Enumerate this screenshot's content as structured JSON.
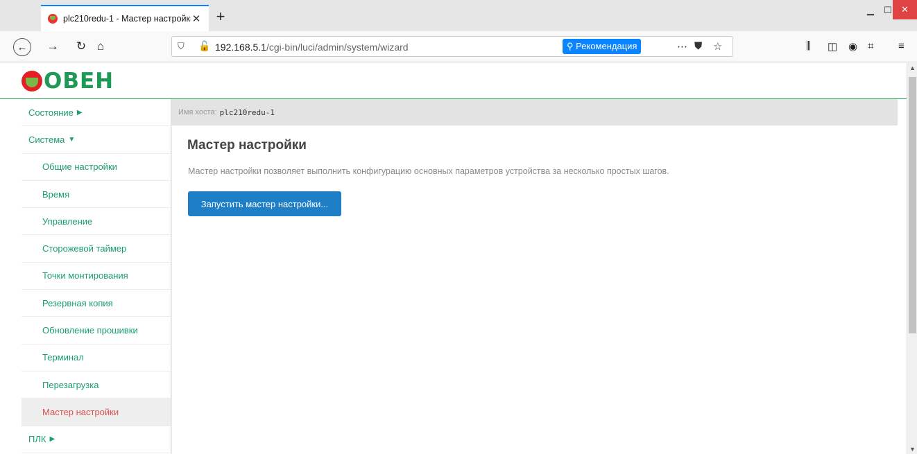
{
  "browser": {
    "tab_title": "plc210redu-1 - Мастер настройки",
    "new_tab": "+",
    "url_host": "192.168.5.1",
    "url_path": "/cgi-bin/luci/admin/system/wizard",
    "recommendation": "Рекомендация"
  },
  "logo_text": "ОВЕН",
  "host": {
    "label": "Имя хоста:",
    "value": "plc210redu-1"
  },
  "sidebar": {
    "items": [
      {
        "label": "Состояние",
        "type": "top",
        "caret": "▶"
      },
      {
        "label": "Система",
        "type": "top",
        "caret": "▼"
      },
      {
        "label": "Общие настройки",
        "type": "sub"
      },
      {
        "label": "Время",
        "type": "sub"
      },
      {
        "label": "Управление",
        "type": "sub"
      },
      {
        "label": "Сторожевой таймер",
        "type": "sub"
      },
      {
        "label": "Точки монтирования",
        "type": "sub"
      },
      {
        "label": "Резервная копия",
        "type": "sub"
      },
      {
        "label": "Обновление прошивки",
        "type": "sub"
      },
      {
        "label": "Терминал",
        "type": "sub"
      },
      {
        "label": "Перезагрузка",
        "type": "sub"
      },
      {
        "label": "Мастер настройки",
        "type": "sub",
        "active": true
      },
      {
        "label": "ПЛК",
        "type": "top",
        "caret": "▶"
      }
    ]
  },
  "main": {
    "title": "Мастер настройки",
    "description": "Мастер настройки позволяет выполнить конфигурацию основных параметров устройства за несколько простых шагов.",
    "button": "Запустить мастер настройки..."
  },
  "colors": {
    "accent": "#1a9e6b",
    "active": "#d9534f",
    "button": "#1e7fc6",
    "brand_red": "#e31e24",
    "brand_green": "#1d9a55"
  }
}
